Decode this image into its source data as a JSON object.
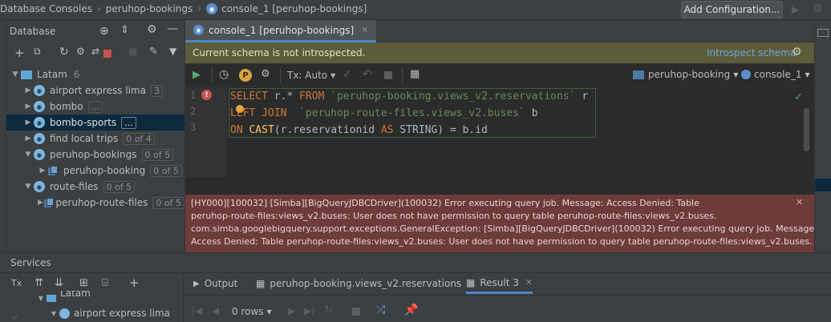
{
  "breadcrumbs": [
    "Database Consoles",
    "peruhop-bookings",
    "console_1 [peruhop-bookings]"
  ],
  "add_configuration_label": "Add Configuration...",
  "db_panel": {
    "title": "Database",
    "tree": [
      {
        "label": "Latam",
        "count": "6",
        "level": 0,
        "type": "folder",
        "expanded": true
      },
      {
        "label": "airport express lima",
        "count": "3",
        "level": 1,
        "type": "db"
      },
      {
        "label": "bombo",
        "count": "...",
        "level": 1,
        "type": "db"
      },
      {
        "label": "bombo-sports",
        "count": "...",
        "level": 1,
        "type": "db",
        "selected": true
      },
      {
        "label": "find local trips",
        "count": "0 of 4",
        "level": 1,
        "type": "db"
      },
      {
        "label": "peruhop-bookings",
        "count": "0 of 5",
        "level": 1,
        "type": "db",
        "expanded": true
      },
      {
        "label": "peruhop-booking",
        "count": "0 of 5",
        "level": 2,
        "type": "schema"
      },
      {
        "label": "route-files",
        "count": "0 of 5",
        "level": 1,
        "type": "db",
        "expanded": true
      },
      {
        "label": "peruhop-route-files",
        "count": "0 of 5",
        "level": 2,
        "type": "schema"
      }
    ]
  },
  "editor": {
    "tab_label": "console_1 [peruhop-bookings]",
    "banner_text": "Current schema is not introspected.",
    "banner_link": "Introspect schema",
    "tx_label": "Tx: Auto",
    "schema_selector": "peruhop-booking",
    "console_selector": "console_1",
    "line_numbers": [
      "1",
      "2",
      "3"
    ],
    "code": {
      "line1": {
        "k1": "SELECT",
        "t1": " r.* ",
        "k2": "FROM",
        "t2": " ",
        "s1": "`peruhop-booking.views_v2.reservations`",
        "t3": " r"
      },
      "line2": {
        "k1": "LEFT JOIN",
        "t1": "  ",
        "s1": "`peruhop-route-files.views_v2.buses`",
        "t2": " b"
      },
      "line3": {
        "k1": "ON",
        "t1": " ",
        "f1": "CAST",
        "t2": "(r.reservationid ",
        "k2": "AS",
        "t3": " STRING) = b.id"
      }
    },
    "error_lines": [
      "[HY000][100032] [Simba][BigQueryJDBCDriver](100032) Error executing query job. Message: Access Denied: Table",
      "peruhop-route-files:views_v2.buses: User does not have permission to query table peruhop-route-files:views_v2.buses.",
      "com.simba.googlebigquery.support.exceptions.GeneralException: [Simba][BigQueryJDBCDriver](100032) Error executing query job. Message:",
      "Access Denied: Table peruhop-route-files:views_v2.buses: User does not have permission to query table peruhop-route-files:views_v2.buses."
    ]
  },
  "services": {
    "title": "Services",
    "tree": [
      {
        "label": "Latam"
      },
      {
        "label": "airport express lima"
      }
    ],
    "tabs": [
      {
        "label": "Output"
      },
      {
        "label": "peruhop-booking.views_v2.reservations"
      },
      {
        "label": "Result 3",
        "active": true
      }
    ],
    "rows_label": "0 rows"
  },
  "colors": {
    "accent": "#4a88c7",
    "error_bg": "#6e3b3b",
    "banner_bg": "#5c5c3b",
    "selection": "#0d293e",
    "run_green": "#59a869"
  }
}
